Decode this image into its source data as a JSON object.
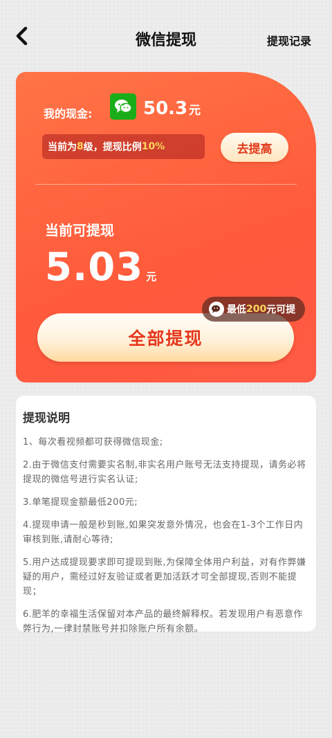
{
  "header": {
    "title": "微信提现",
    "history_label": "提现记录"
  },
  "card": {
    "cash_label": "我的现金:",
    "cash_value": "50.3",
    "cash_unit": "元",
    "level_prefix": "当前为",
    "level_value": "8",
    "level_mid": "级，提现比例",
    "ratio_value": "10%",
    "upgrade_label": "去提高",
    "current_label": "当前可提现",
    "current_value": "5.03",
    "current_unit": "元",
    "min_prefix": "最低",
    "min_value": "200",
    "min_suffix": "元可提",
    "withdraw_label": "全部提现"
  },
  "notes": {
    "title": "提现说明",
    "items": [
      "1、每次看视频都可获得微信现金;",
      "2.由于微信支付需要实名制,非实名用户账号无法支持提现，请务必将提现的微信号进行实名认证;",
      "3.单笔提现金额最低200元;",
      "4.提现申请一般是秒到账,如果突发意外情况，也会在1-3个工作日内审核到账,请耐心等待;",
      "5.用户达成提现要求即可提现到账,为保障全体用户利益，对有作弊嫌疑的用户，需经过好友验证或者更加活跃才可全部提现,否则不能提现；",
      "6.肥羊的幸福生活保留对本产品的最终解释权。若发现用户有恶意作弊行为,一律封禁账号并扣除账户所有余额。"
    ]
  },
  "colors": {
    "accent": "#ff5a3b",
    "highlight": "#ffd45e",
    "wechat_green": "#1aad19"
  },
  "icons": {
    "back": "chevron-left-icon",
    "wechat": "wechat-icon"
  }
}
